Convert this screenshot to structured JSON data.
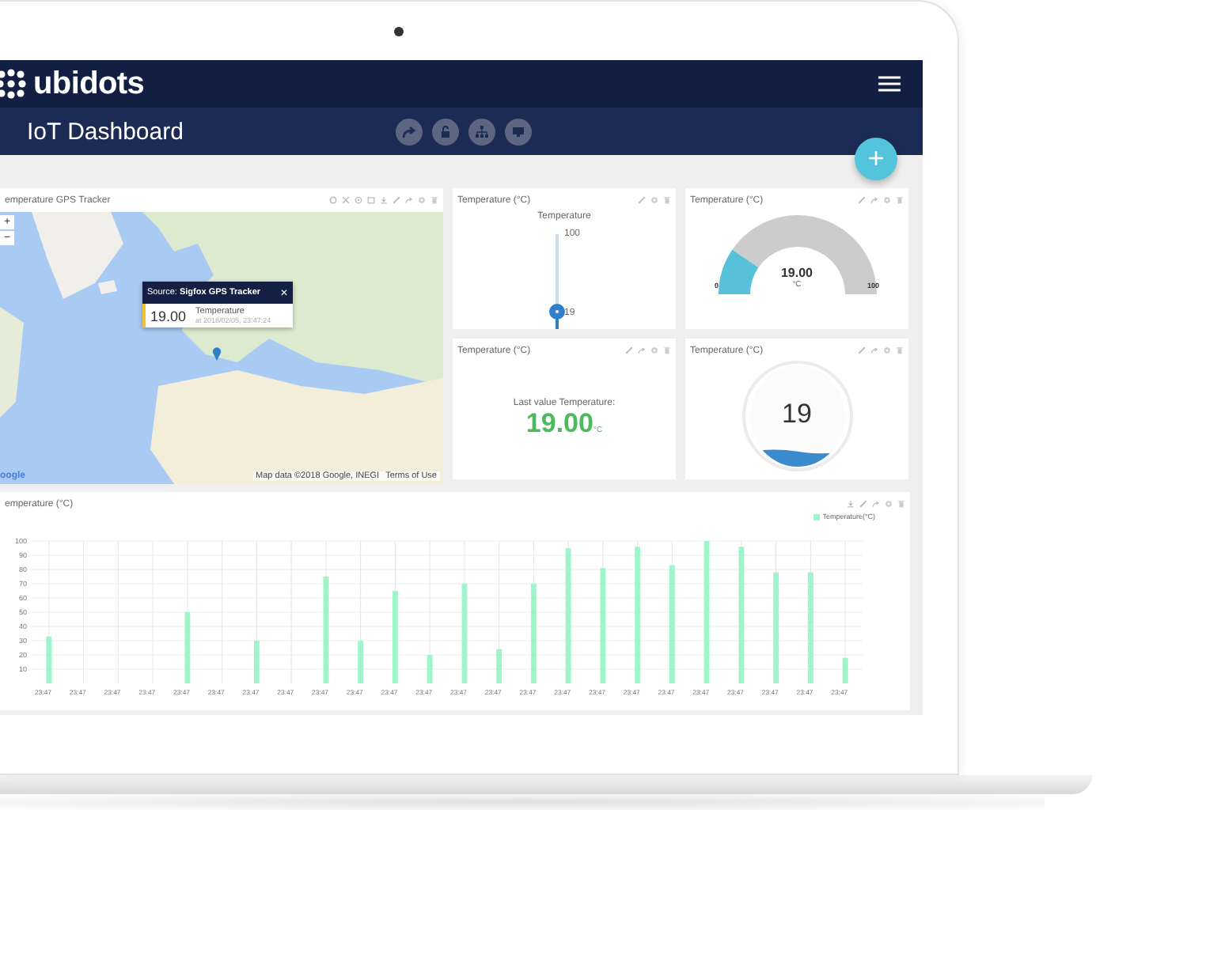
{
  "header": {
    "logo": "ubidots"
  },
  "add_button": "+",
  "toolbar": {
    "title": "IoT Dashboard"
  },
  "widgets": [
    {
      "kind": "map",
      "title": "emperature GPS Tracker",
      "zoom_in": "+",
      "zoom_out": "−",
      "popup": {
        "source": "Source: **Sigfox GPS Tracker**",
        "close": "✕",
        "value": "19.00",
        "variable": "Temperature",
        "timestamp": "at 2018/02/05, 23:47:24"
      },
      "attribution": "Map data ©2018 Google, INEGI",
      "terms": "Terms of Use",
      "logo": "oogle"
    },
    {
      "kind": "slider",
      "title": "Temperature (°C)",
      "label": "Temperature",
      "max": "100",
      "reading": "19",
      "level": 0.19
    },
    {
      "kind": "gauge",
      "title": "Temperature (°C)",
      "value": "19.00",
      "unit": "°C",
      "min": "0",
      "max": "100",
      "level": 0.19
    },
    {
      "kind": "metric",
      "title": "Temperature (°C)",
      "label": "Last value Temperature:",
      "value": "19.00",
      "unit": "°C"
    },
    {
      "kind": "tank",
      "title": "Temperature (°C)",
      "value": "19",
      "level": 0.19
    },
    {
      "kind": "chart",
      "title": "emperature (°C)",
      "chart_data": {
        "type": "bar",
        "grid": true,
        "categories": [
          "23:47",
          "23:47",
          "23:47",
          "23:47",
          "23:47",
          "23:47",
          "23:47",
          "23:47",
          "23:47",
          "23:47",
          "23:47",
          "23:47",
          "23:47",
          "23:47",
          "23:47",
          "23:47",
          "23:47",
          "23:47",
          "23:47",
          "23:47",
          "23:47",
          "23:47",
          "23:47",
          "23:47"
        ],
        "ylim": [
          0,
          100
        ],
        "yticks": [
          10,
          20,
          30,
          40,
          50,
          60,
          70,
          80,
          90,
          100
        ],
        "series": [
          {
            "name": "Temperature(°C)",
            "color": "#9ef5c9",
            "values": [
              33,
              null,
              null,
              null,
              50,
              null,
              30,
              null,
              75,
              30,
              65,
              20,
              70,
              24,
              70,
              95,
              81,
              96,
              83,
              100,
              96,
              78,
              78,
              18
            ]
          }
        ]
      }
    }
  ]
}
